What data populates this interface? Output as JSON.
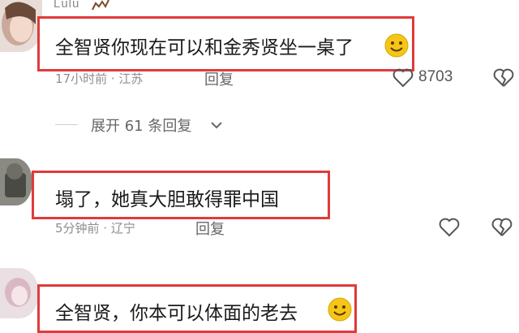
{
  "comments": [
    {
      "username": "Lulu",
      "text": "全智贤你现在可以和金秀贤坐一桌了",
      "meta": "17小时前 · 江苏",
      "reply_label": "回复",
      "likes": "8703"
    },
    {
      "username": "",
      "text": "塌了，她真大胆敢得罪中国",
      "meta": "5分钟前 · 辽宁",
      "reply_label": "回复",
      "likes": ""
    },
    {
      "username": "",
      "text": "全智贤，你本可以体面的老去",
      "meta": "",
      "reply_label": "",
      "likes": ""
    }
  ],
  "expand_replies": "展开 61 条回复",
  "colors": {
    "highlight_border": "#e03a3a",
    "meta_text": "#8e8e8e",
    "emoji": "#f5c518"
  },
  "icons": [
    "heart-icon",
    "broken-heart-icon",
    "chevron-down-icon",
    "smile-emoji-icon"
  ]
}
